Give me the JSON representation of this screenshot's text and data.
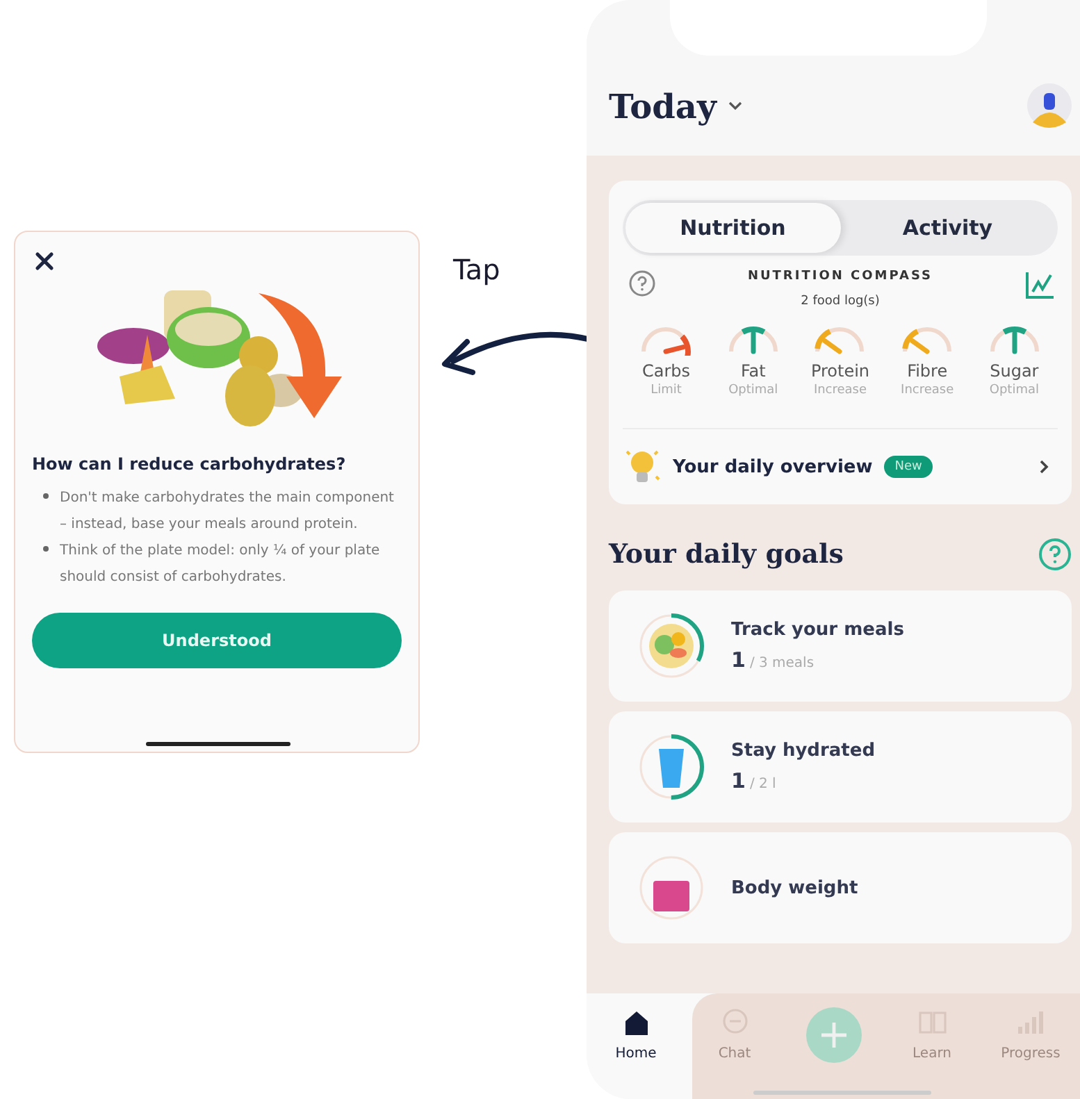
{
  "tip_card": {
    "title": "How can I reduce carbohydrates?",
    "bullets": [
      "Don't make carbohydrates the main component – instead, base your meals around protein.",
      "Think of the plate model: only ¼ of your plate should consist of carbohydrates."
    ],
    "button": "Understood"
  },
  "annotation": {
    "label": "Tap"
  },
  "phone": {
    "header": {
      "title": "Today"
    },
    "tabs": [
      {
        "label": "Nutrition",
        "selected": true
      },
      {
        "label": "Activity",
        "selected": false
      }
    ],
    "compass": {
      "title": "NUTRITION COMPASS",
      "subtitle": "2 food log(s)",
      "gauges": [
        {
          "kind": "limit",
          "name": "Carbs",
          "status": "Limit",
          "color": "#e8542c"
        },
        {
          "kind": "optimal",
          "name": "Fat",
          "status": "Optimal",
          "color": "#1fa383"
        },
        {
          "kind": "increase",
          "name": "Protein",
          "status": "Increase",
          "color": "#f0aa1e"
        },
        {
          "kind": "increase",
          "name": "Fibre",
          "status": "Increase",
          "color": "#f0aa1e"
        },
        {
          "kind": "optimal",
          "name": "Sugar",
          "status": "Optimal",
          "color": "#1fa383"
        }
      ]
    },
    "overview": {
      "label": "Your daily overview",
      "badge": "New"
    },
    "goals_title": "Your daily goals",
    "goals": [
      {
        "kind": "meals",
        "title": "Track your meals",
        "count": "1",
        "target": "/ 3 meals",
        "level": 0.33
      },
      {
        "kind": "water",
        "title": "Stay hydrated",
        "count": "1",
        "target": "/ 2 l",
        "level": 0.5
      },
      {
        "kind": "weight",
        "title": "Body weight",
        "level": 0
      }
    ],
    "nav": [
      {
        "kind": "home",
        "label": "Home",
        "selected": true
      },
      {
        "kind": "chat",
        "label": "Chat",
        "selected": false
      },
      {
        "kind": "add",
        "selected": false
      },
      {
        "kind": "learn",
        "label": "Learn",
        "selected": false
      },
      {
        "kind": "progress",
        "label": "Progress",
        "selected": false
      }
    ]
  }
}
